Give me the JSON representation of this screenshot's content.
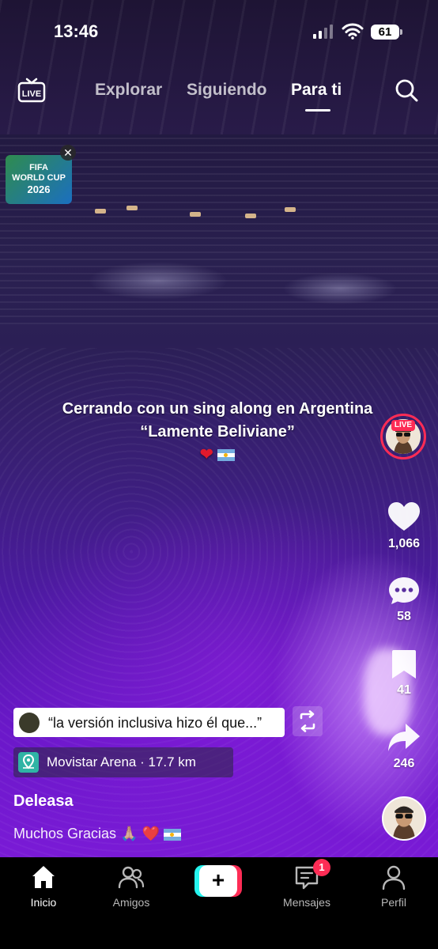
{
  "status_bar": {
    "time": "13:46",
    "battery": "61"
  },
  "top_nav": {
    "tabs": [
      {
        "label": "Explorar"
      },
      {
        "label": "Siguiendo"
      },
      {
        "label": "Para ti"
      }
    ],
    "active_tab": "Para ti",
    "live_label": "LIVE"
  },
  "promo": {
    "line1": "FIFA",
    "line2": "WORLD CUP",
    "line3": "2026"
  },
  "video": {
    "caption_line1": "Cerrando con un sing along en Argentina",
    "caption_line2": "“Lamente Beliviane”"
  },
  "rail": {
    "live_badge": "LIVE",
    "likes": "1,066",
    "comments": "58",
    "saves": "41",
    "shares": "246"
  },
  "post": {
    "comment_preview": "“la versión inclusiva hizo él que...”",
    "location": "Movistar Arena · 17.7 km",
    "username": "Deleasa",
    "description": "Muchos Gracias 🙏🏼 ❤️"
  },
  "bottom_nav": {
    "items": [
      {
        "label": "Inicio",
        "icon": "home-icon",
        "active": true
      },
      {
        "label": "Amigos",
        "icon": "friends-icon",
        "active": false
      },
      {
        "label": "",
        "icon": "create-icon",
        "active": false
      },
      {
        "label": "Mensajes",
        "icon": "inbox-icon",
        "active": false
      },
      {
        "label": "Perfil",
        "icon": "profile-icon",
        "active": false
      }
    ],
    "messages_badge": "1"
  },
  "colors": {
    "accent_pink": "#fe2c55",
    "accent_cyan": "#25f4ee",
    "location_pin": "#2fb4a5"
  }
}
